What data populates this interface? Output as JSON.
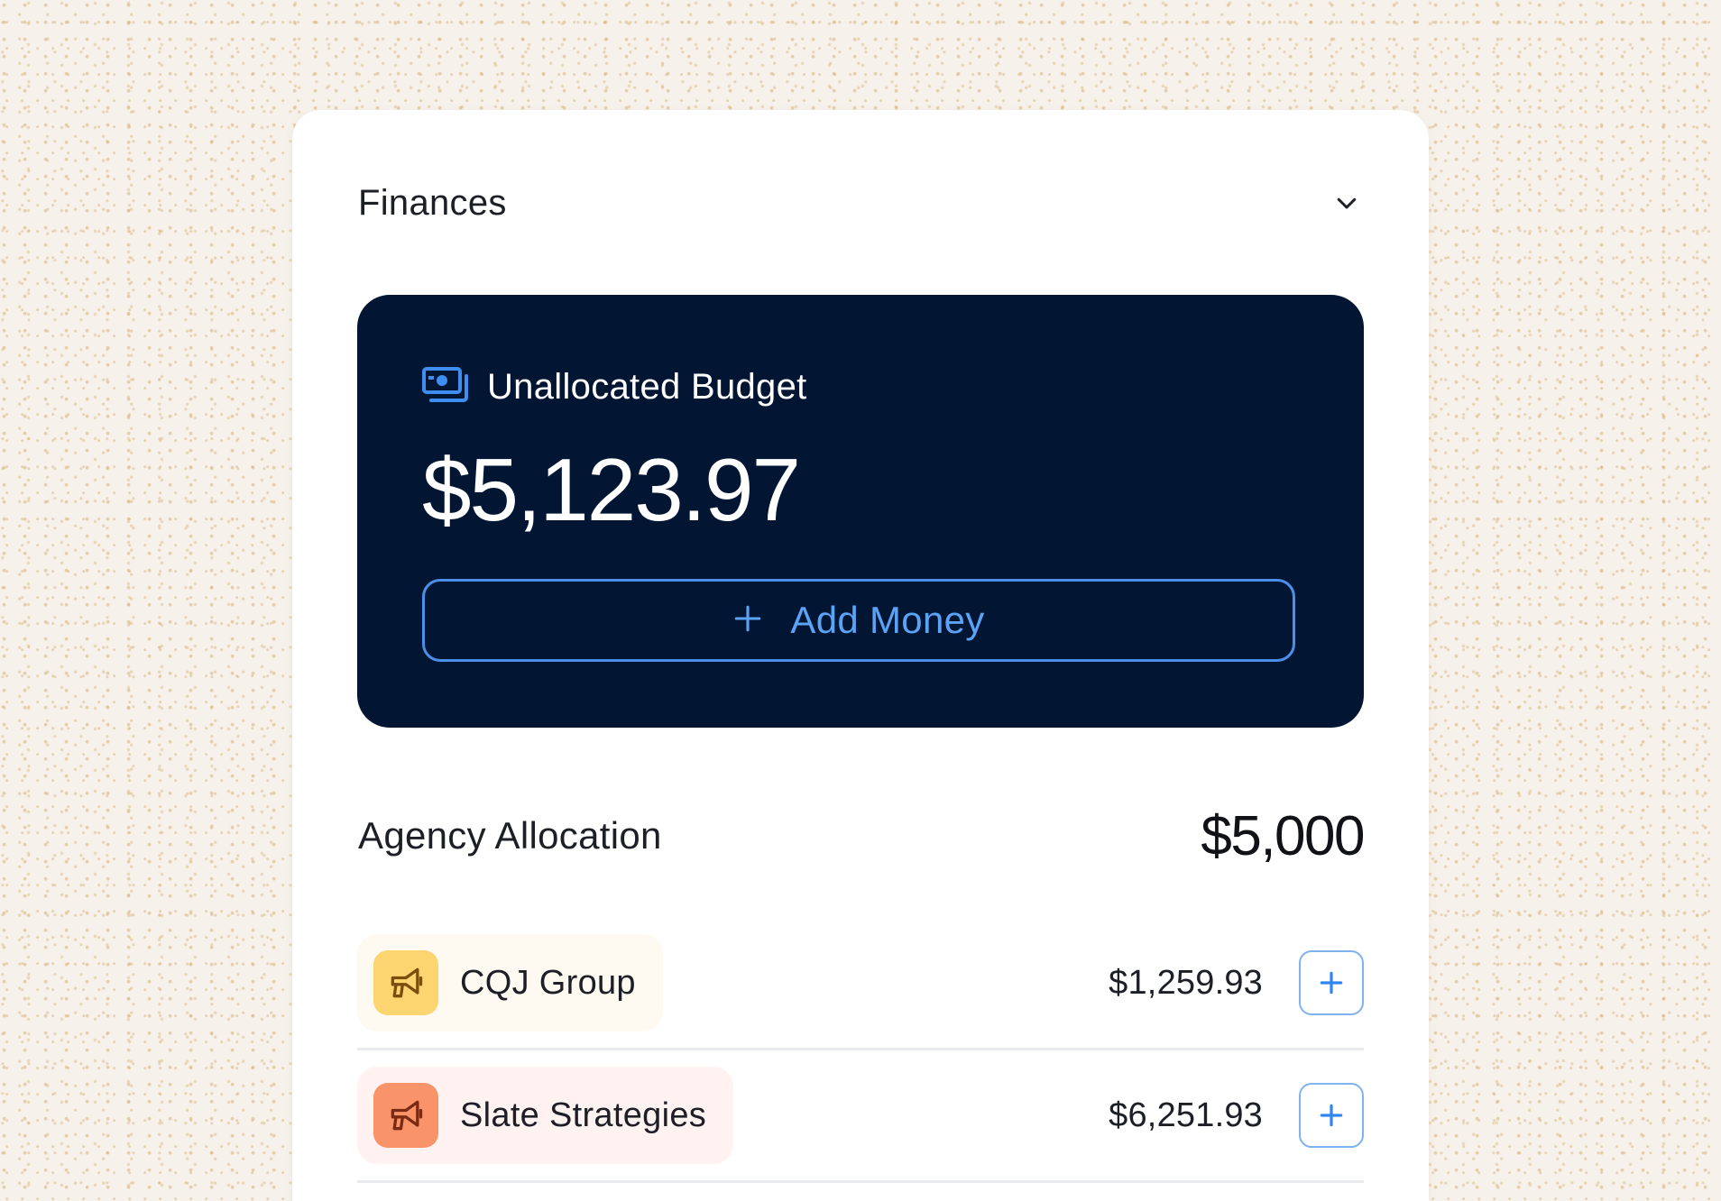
{
  "finances": {
    "title": "Finances"
  },
  "budget": {
    "label": "Unallocated Budget",
    "amount": "$5,123.97",
    "add_money_label": "Add Money"
  },
  "allocation": {
    "label": "Agency Allocation",
    "total": "$5,000"
  },
  "agencies": [
    {
      "name": "CQJ Group",
      "amount": "$1,259.93",
      "icon": "megaphone-icon"
    },
    {
      "name": "Slate Strategies",
      "amount": "$6,251.93",
      "icon": "megaphone-icon"
    }
  ],
  "colors": {
    "panel_bg": "#021634",
    "accent_blue": "#4a90ea",
    "chip_yellow": "#fcd570",
    "chip_orange": "#f9946a"
  }
}
